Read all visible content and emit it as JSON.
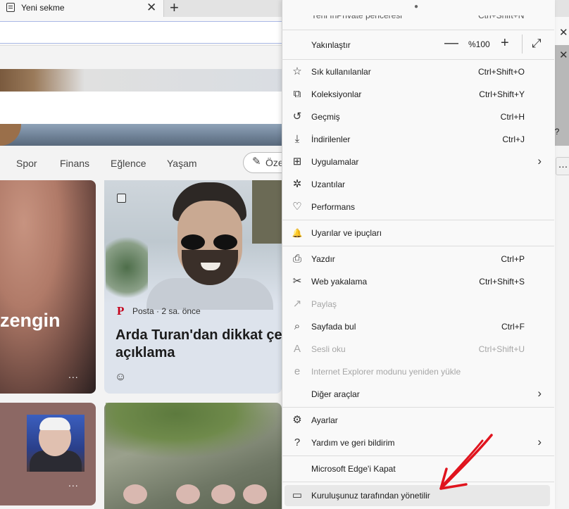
{
  "tab": {
    "title": "Yeni sekme",
    "close": "✕",
    "new_tab": "+"
  },
  "browser_right": {
    "close1": "✕",
    "close2": "✕",
    "partial_text": "i?",
    "more": "…"
  },
  "nav": {
    "items": [
      "Spor",
      "Finans",
      "Eğlence",
      "Yaşam"
    ],
    "personalize_label": "Öze",
    "personalize_icon": "✎"
  },
  "cards": {
    "card1_headline": "zengin",
    "card1_more": "...",
    "card2_source_logo": "P",
    "card2_source": "Posta · 2 sa. önce",
    "card2_headline_1": "Arda Turan'dan dikkat çeken",
    "card2_headline_2": "açıklama",
    "card2_reaction_icon": "☺",
    "card3_more": "..."
  },
  "menu": {
    "top_partial_label": "Yeni InPrivate penceresi",
    "top_partial_shortcut": "Ctrl+Shift+N",
    "zoom": {
      "label": "Yakınlaştır",
      "minus": "—",
      "value": "%100",
      "plus": "+",
      "fullscreen_icon": "⤢"
    },
    "items": [
      {
        "icon": "☆",
        "label": "Sık kullanılanlar",
        "shortcut": "Ctrl+Shift+O"
      },
      {
        "icon": "⧉",
        "label": "Koleksiyonlar",
        "shortcut": "Ctrl+Shift+Y"
      },
      {
        "icon": "↺",
        "label": "Geçmiş",
        "shortcut": "Ctrl+H"
      },
      {
        "icon": "⤓",
        "label": "İndirilenler",
        "shortcut": "Ctrl+J"
      },
      {
        "icon": "⊞",
        "label": "Uygulamalar",
        "chevron": "›"
      },
      {
        "icon": "✲",
        "label": "Uzantılar"
      },
      {
        "icon": "♡",
        "label": "Performans"
      },
      {
        "icon": "🔔",
        "label": "Uyarılar ve ipuçları"
      },
      {
        "icon": "⎙",
        "label": "Yazdır",
        "shortcut": "Ctrl+P"
      },
      {
        "icon": "✂",
        "label": "Web yakalama",
        "shortcut": "Ctrl+Shift+S"
      },
      {
        "icon": "↗",
        "label": "Paylaş"
      },
      {
        "icon": "⌕",
        "label": "Sayfada bul",
        "shortcut": "Ctrl+F"
      },
      {
        "icon": "A",
        "label": "Sesli oku",
        "shortcut": "Ctrl+Shift+U"
      },
      {
        "icon": "e",
        "label": "Internet Explorer modunu yeniden yükle"
      },
      {
        "label": "Diğer araçlar",
        "chevron": "›"
      },
      {
        "icon": "⚙",
        "label": "Ayarlar"
      },
      {
        "icon": "?",
        "label": "Yardım ve geri bildirim",
        "chevron": "›"
      },
      {
        "label": "Microsoft Edge'i Kapat"
      },
      {
        "icon": "▭",
        "label": "Kuruluşunuz tarafından yönetilir"
      }
    ]
  },
  "colors": {
    "annotation": "#e0141e",
    "menu_bg": "#f9f9f9",
    "managed_bg": "#e8e8e8"
  }
}
